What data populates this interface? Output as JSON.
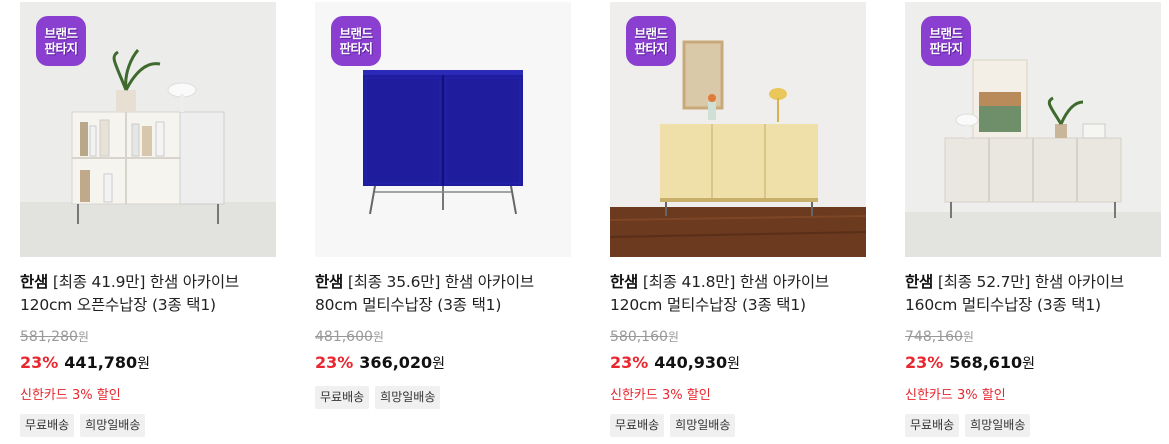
{
  "products": [
    {
      "badge_line1": "브랜드",
      "badge_line2": "판타지",
      "brand": "한샘",
      "title": " [최종 41.9만] 한샘 아카이브 120cm 오픈수납장 (3종 택1)",
      "original_price": "581,280",
      "original_unit": "원",
      "discount_rate": "23%",
      "price": "441,780",
      "price_unit": "원",
      "promo": "신한카드 3% 할인",
      "tags": [
        "무료배송",
        "희망일배송"
      ]
    },
    {
      "badge_line1": "브랜드",
      "badge_line2": "판타지",
      "brand": "한샘",
      "title": " [최종 35.6만] 한샘 아카이브 80cm 멀티수납장 (3종 택1)",
      "original_price": "481,600",
      "original_unit": "원",
      "discount_rate": "23%",
      "price": "366,020",
      "price_unit": "원",
      "promo": "",
      "tags": [
        "무료배송",
        "희망일배송"
      ]
    },
    {
      "badge_line1": "브랜드",
      "badge_line2": "판타지",
      "brand": "한샘",
      "title": " [최종 41.8만] 한샘 아카이브 120cm 멀티수납장 (3종 택1)",
      "original_price": "580,160",
      "original_unit": "원",
      "discount_rate": "23%",
      "price": "440,930",
      "price_unit": "원",
      "promo": "신한카드 3% 할인",
      "tags": [
        "무료배송",
        "희망일배송"
      ]
    },
    {
      "badge_line1": "브랜드",
      "badge_line2": "판타지",
      "brand": "한샘",
      "title": " [최종 52.7만] 한샘 아카이브 160cm 멀티수납장 (3종 택1)",
      "original_price": "748,160",
      "original_unit": "원",
      "discount_rate": "23%",
      "price": "568,610",
      "price_unit": "원",
      "promo": "신한카드 3% 할인",
      "tags": [
        "무료배송",
        "희망일배송"
      ]
    }
  ],
  "colors": {
    "accent_red": "#e8272e",
    "badge_purple": "#8a3fd1",
    "strike_gray": "#999999",
    "tag_bg": "#f0f0f0"
  }
}
